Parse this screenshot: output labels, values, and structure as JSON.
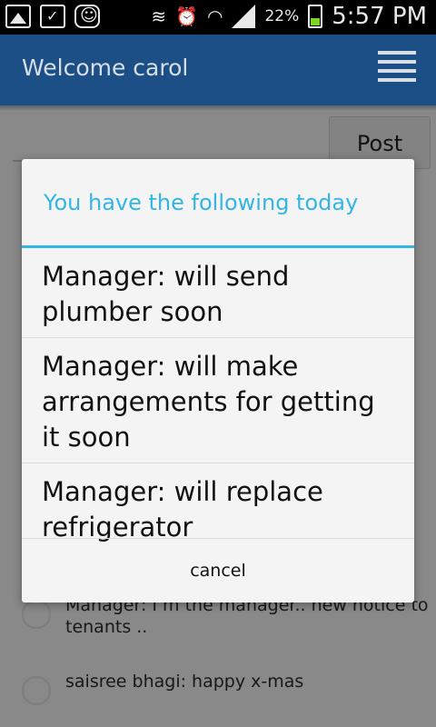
{
  "status_bar": {
    "battery": "22%",
    "time": "5:57 PM"
  },
  "action_bar": {
    "title": "Welcome carol",
    "menu_icon": "hamburger-menu-icon"
  },
  "composer": {
    "post_label": "Post"
  },
  "feed": [
    {
      "text": "Manager: I m the manager.. new notice to tenants .."
    },
    {
      "text": "saisree bhagi: happy x-mas"
    }
  ],
  "dialog": {
    "title": "You have the following today",
    "items": [
      "Manager: will send plumber soon",
      "Manager: will make arrangements for getting it soon",
      "Manager: will replace refrigerator"
    ],
    "cancel_label": "cancel"
  },
  "colors": {
    "action_bar": "#1c4f86",
    "accent": "#33b5e5"
  }
}
